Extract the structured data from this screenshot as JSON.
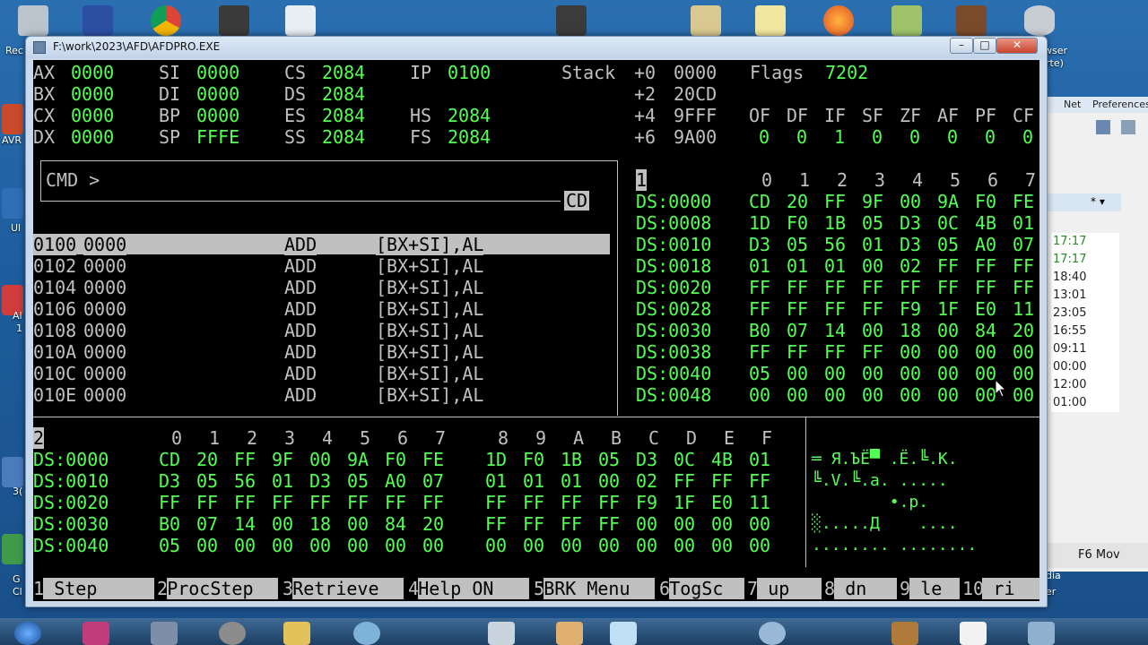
{
  "desktop": {
    "labels": [
      "Rec",
      "AVR",
      "Ul",
      "Al",
      "1",
      "3(",
      "G",
      "Cl"
    ],
    "right_labels": [
      "wser",
      "rte)"
    ]
  },
  "bg_window": {
    "toolbar": [
      "Net",
      "Preferences"
    ],
    "times": [
      "17:17",
      "17:17",
      "18:40",
      "13:01",
      "23:05",
      "16:55",
      "09:11",
      "00:00",
      "12:00",
      "01:00"
    ],
    "footer": "F6 Mov",
    "edge_labels": [
      "dia",
      "er"
    ]
  },
  "window": {
    "title": "F:\\work\\2023\\AFD\\AFDPRO.EXE",
    "minimize": "–",
    "maximize": "□",
    "close": "✕"
  },
  "registers": [
    {
      "name": "AX",
      "value": "0000"
    },
    {
      "name": "BX",
      "value": "0000"
    },
    {
      "name": "CX",
      "value": "0000"
    },
    {
      "name": "DX",
      "value": "0000"
    },
    {
      "name": "SI",
      "value": "0000"
    },
    {
      "name": "DI",
      "value": "0000"
    },
    {
      "name": "BP",
      "value": "0000"
    },
    {
      "name": "SP",
      "value": "FFFE"
    },
    {
      "name": "CS",
      "value": "2084"
    },
    {
      "name": "DS",
      "value": "2084"
    },
    {
      "name": "ES",
      "value": "2084"
    },
    {
      "name": "SS",
      "value": "2084"
    },
    {
      "name": "IP",
      "value": "0100"
    },
    {
      "name": "HS",
      "value": "2084"
    },
    {
      "name": "FS",
      "value": "2084"
    }
  ],
  "stack": {
    "label": "Stack",
    "rows": [
      {
        "offset": "+0",
        "value": "0000"
      },
      {
        "offset": "+2",
        "value": "20CD"
      },
      {
        "offset": "+4",
        "value": "9FFF"
      },
      {
        "offset": "+6",
        "value": "9A00"
      }
    ]
  },
  "flags": {
    "label": "Flags",
    "value": "7202",
    "names": [
      "OF",
      "DF",
      "IF",
      "SF",
      "ZF",
      "AF",
      "PF",
      "CF"
    ],
    "values": [
      "0",
      "0",
      "1",
      "0",
      "0",
      "0",
      "0",
      "0"
    ]
  },
  "cmd": {
    "prompt": "CMD >",
    "tag": "CD"
  },
  "disasm": [
    {
      "addr": "0100",
      "code": "0000",
      "op": "ADD",
      "args": "[BX+SI],AL"
    },
    {
      "addr": "0102",
      "code": "0000",
      "op": "ADD",
      "args": "[BX+SI],AL"
    },
    {
      "addr": "0104",
      "code": "0000",
      "op": "ADD",
      "args": "[BX+SI],AL"
    },
    {
      "addr": "0106",
      "code": "0000",
      "op": "ADD",
      "args": "[BX+SI],AL"
    },
    {
      "addr": "0108",
      "code": "0000",
      "op": "ADD",
      "args": "[BX+SI],AL"
    },
    {
      "addr": "010A",
      "code": "0000",
      "op": "ADD",
      "args": "[BX+SI],AL"
    },
    {
      "addr": "010C",
      "code": "0000",
      "op": "ADD",
      "args": "[BX+SI],AL"
    },
    {
      "addr": "010E",
      "code": "0000",
      "op": "ADD",
      "args": "[BX+SI],AL"
    }
  ],
  "dump1": {
    "panel": "1",
    "header": [
      "0",
      "1",
      "2",
      "3",
      "4",
      "5",
      "6",
      "7"
    ],
    "rows": [
      {
        "addr": "DS:0000",
        "bytes": [
          "CD",
          "20",
          "FF",
          "9F",
          "00",
          "9A",
          "F0",
          "FE"
        ]
      },
      {
        "addr": "DS:0008",
        "bytes": [
          "1D",
          "F0",
          "1B",
          "05",
          "D3",
          "0C",
          "4B",
          "01"
        ]
      },
      {
        "addr": "DS:0010",
        "bytes": [
          "D3",
          "05",
          "56",
          "01",
          "D3",
          "05",
          "A0",
          "07"
        ]
      },
      {
        "addr": "DS:0018",
        "bytes": [
          "01",
          "01",
          "01",
          "00",
          "02",
          "FF",
          "FF",
          "FF"
        ]
      },
      {
        "addr": "DS:0020",
        "bytes": [
          "FF",
          "FF",
          "FF",
          "FF",
          "FF",
          "FF",
          "FF",
          "FF"
        ]
      },
      {
        "addr": "DS:0028",
        "bytes": [
          "FF",
          "FF",
          "FF",
          "FF",
          "F9",
          "1F",
          "E0",
          "11"
        ]
      },
      {
        "addr": "DS:0030",
        "bytes": [
          "B0",
          "07",
          "14",
          "00",
          "18",
          "00",
          "84",
          "20"
        ]
      },
      {
        "addr": "DS:0038",
        "bytes": [
          "FF",
          "FF",
          "FF",
          "FF",
          "00",
          "00",
          "00",
          "00"
        ]
      },
      {
        "addr": "DS:0040",
        "bytes": [
          "05",
          "00",
          "00",
          "00",
          "00",
          "00",
          "00",
          "00"
        ]
      },
      {
        "addr": "DS:0048",
        "bytes": [
          "00",
          "00",
          "00",
          "00",
          "00",
          "00",
          "00",
          "00"
        ]
      }
    ]
  },
  "dump2": {
    "panel": "2",
    "header": [
      "0",
      "1",
      "2",
      "3",
      "4",
      "5",
      "6",
      "7",
      "8",
      "9",
      "A",
      "B",
      "C",
      "D",
      "E",
      "F"
    ],
    "rows": [
      {
        "addr": "DS:0000",
        "bytes": [
          "CD",
          "20",
          "FF",
          "9F",
          "00",
          "9A",
          "F0",
          "FE",
          "1D",
          "F0",
          "1B",
          "05",
          "D3",
          "0C",
          "4B",
          "01"
        ],
        "ascii": "═ Я.ЪЁ▀ .Ё.╚.K."
      },
      {
        "addr": "DS:0010",
        "bytes": [
          "D3",
          "05",
          "56",
          "01",
          "D3",
          "05",
          "A0",
          "07",
          "01",
          "01",
          "01",
          "00",
          "02",
          "FF",
          "FF",
          "FF"
        ],
        "ascii": "╚.V.╚.а. ....."
      },
      {
        "addr": "DS:0020",
        "bytes": [
          "FF",
          "FF",
          "FF",
          "FF",
          "FF",
          "FF",
          "FF",
          "FF",
          "FF",
          "FF",
          "FF",
          "FF",
          "F9",
          "1F",
          "E0",
          "11"
        ],
        "ascii": "        •.р."
      },
      {
        "addr": "DS:0030",
        "bytes": [
          "B0",
          "07",
          "14",
          "00",
          "18",
          "00",
          "84",
          "20",
          "FF",
          "FF",
          "FF",
          "FF",
          "00",
          "00",
          "00",
          "00"
        ],
        "ascii": "░.....Д    ...."
      },
      {
        "addr": "DS:0040",
        "bytes": [
          "05",
          "00",
          "00",
          "00",
          "00",
          "00",
          "00",
          "00",
          "00",
          "00",
          "00",
          "00",
          "00",
          "00",
          "00",
          "00"
        ],
        "ascii": "........ ........"
      }
    ]
  },
  "fkeys": [
    {
      "num": "1",
      "label": " Step "
    },
    {
      "num": "2",
      "label": "ProcStep"
    },
    {
      "num": "3",
      "label": "Retrieve"
    },
    {
      "num": "4",
      "label": "Help ON "
    },
    {
      "num": "5",
      "label": "BRK Menu"
    },
    {
      "num": "6",
      "label": "TogSc"
    },
    {
      "num": "7",
      "label": " up "
    },
    {
      "num": "8",
      "label": " dn "
    },
    {
      "num": "9",
      "label": " le "
    },
    {
      "num": "10",
      "label": " ri "
    }
  ],
  "colors": {
    "green": "#54ff54",
    "gray": "#c0c0c0",
    "bg": "#000000"
  }
}
